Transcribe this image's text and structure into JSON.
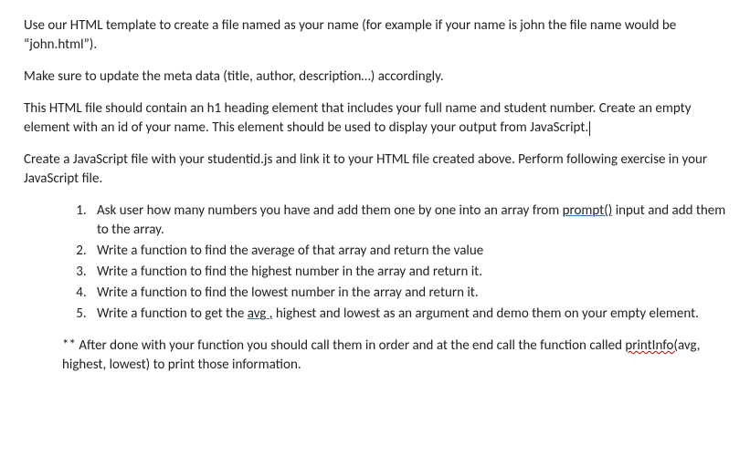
{
  "p1a": "Use our HTML template to create a file named as your name (for example if your name is john the file name would be “john.html”).",
  "p2": "Make sure to update the meta data (title, author, description…) accordingly.",
  "p3": "This HTML file should contain an h1 heading element that includes your full name and student number. Create an empty element with an id of your name. This element should be used to display your output from JavaScript.",
  "p4": "Create a JavaScript file with your studentid.js and link it to your HTML file created above. Perform following exercise in your JavaScript file.",
  "list": {
    "i1_a": "Ask user how many numbers you have and add them one by one into an array from ",
    "i1_u": "prompt()",
    "i1_b": " input and add them to the array.",
    "i2": "Write a function to find the average of that array and return the value",
    "i3": "Write a function to find the highest number in the array and return it.",
    "i4": "Write a function to find the lowest number in the array and return it.",
    "i5_a": "Write a function to get the ",
    "i5_u": "avg ,",
    "i5_b": " highest and lowest as an argument and demo them on your empty element."
  },
  "p5_a": "** After done with your function you should call them in order and at the end call the function called ",
  "p5_u1": "printInfo(",
  "p5_u2": "avg",
  "p5_b": ", highest, lowest) to print those information."
}
